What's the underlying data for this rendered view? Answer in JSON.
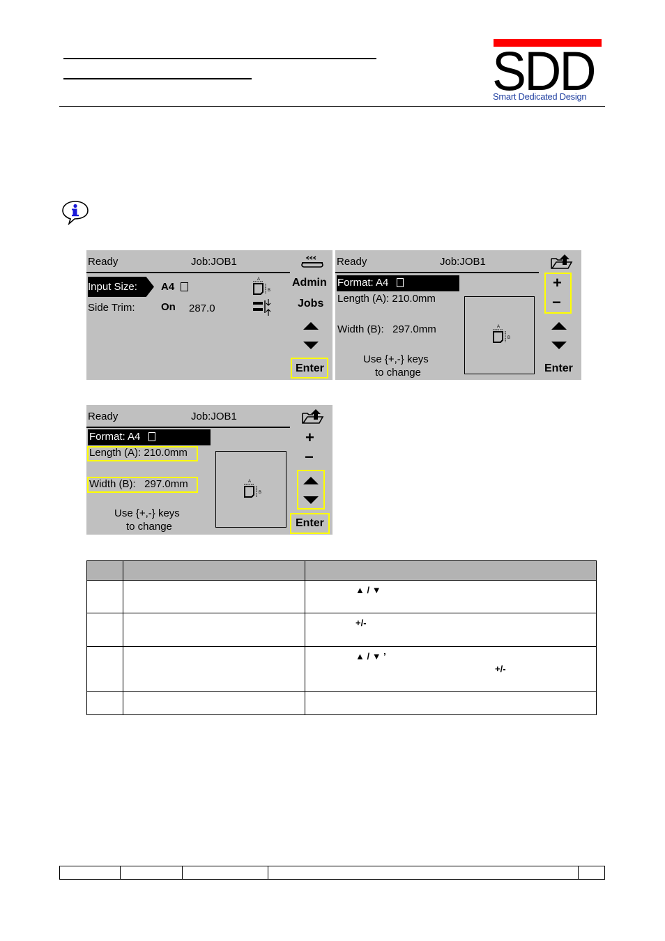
{
  "header": {
    "logo": {
      "brand": "SDD",
      "tagline": "Smart Dedicated Design",
      "bar_color": "#ff0000",
      "tagline_color": "#1f3fa0"
    }
  },
  "note": {
    "icon": "info-icon"
  },
  "screens": [
    {
      "id": "main",
      "status": "Ready",
      "job": "Job:JOB1",
      "rows": [
        {
          "label": "Input Size:",
          "value": "A4",
          "value_icon": "portrait-page-icon",
          "selected": true
        },
        {
          "label": "Side Trim:",
          "value": "On",
          "extra": "287.0",
          "selected": false
        }
      ],
      "softkeys": {
        "top_icon": "conveyor-icon",
        "admin": "Admin",
        "jobs": "Jobs",
        "up": "up-arrow",
        "down": "down-arrow",
        "enter": "Enter"
      },
      "highlight": [
        "Enter"
      ]
    },
    {
      "id": "format-edit",
      "status": "Ready",
      "job": "Job:JOB1",
      "format": "Format: A4",
      "length": "Length (A): 210.0mm",
      "width": "Width (B):   297.0mm",
      "hint_line1": "Use {+,-} keys",
      "hint_line2": "to change",
      "softkeys": {
        "top_icon": "folder-export-icon",
        "plus": "+",
        "minus": "−",
        "up": "up-arrow",
        "down": "down-arrow",
        "enter": "Enter"
      },
      "highlight": [
        "+",
        "−"
      ]
    },
    {
      "id": "format-navigate",
      "status": "Ready",
      "job": "Job:JOB1",
      "format": "Format: A4",
      "length": "Length (A): 210.0mm",
      "width": "Width (B):   297.0mm",
      "hint_line1": "Use {+,-} keys",
      "hint_line2": "to change",
      "softkeys": {
        "top_icon": "folder-export-icon",
        "plus": "+",
        "minus": "−",
        "up": "up-arrow",
        "down": "down-arrow",
        "enter": "Enter"
      },
      "highlight": [
        "Length (A)",
        "Width (B)",
        "up/down",
        "Enter"
      ]
    }
  ],
  "table": {
    "header_color": "#b3b3b3",
    "rows": [
      {
        "col3_glyphs": "▲ / ▼",
        "col3_glyphs2": ""
      },
      {
        "col3_glyphs": "+/-",
        "col3_glyphs2": ""
      },
      {
        "col3_glyphs": "▲ / ▼ ’",
        "col3_glyphs2": "+/-"
      },
      {
        "col3_glyphs": "",
        "col3_glyphs2": ""
      }
    ]
  }
}
